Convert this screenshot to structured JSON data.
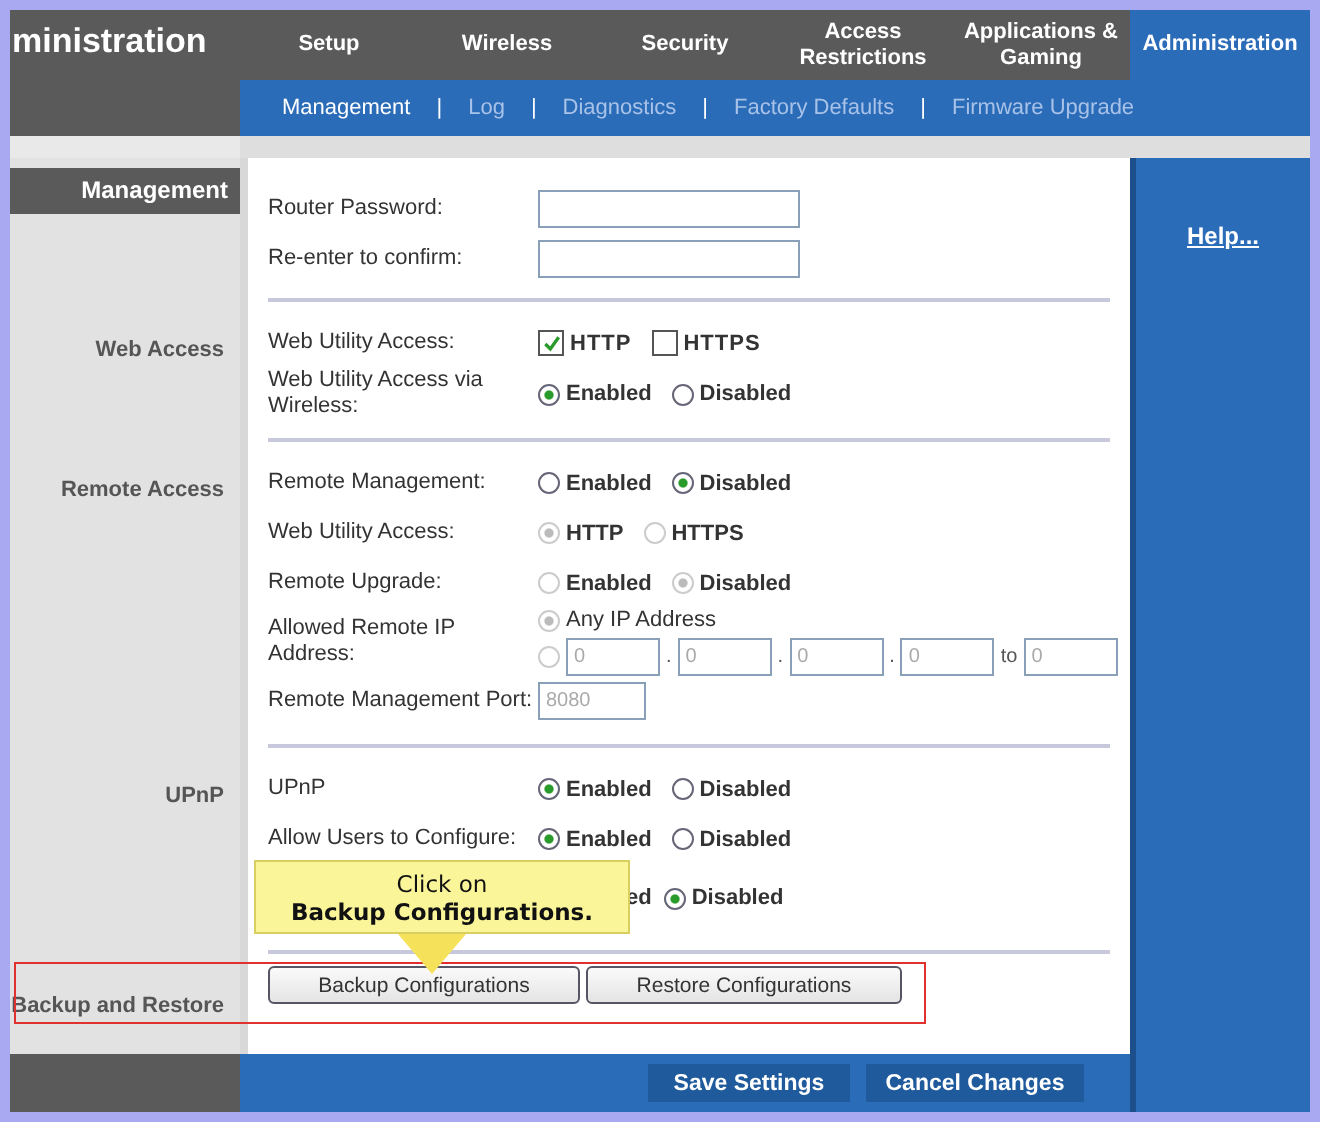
{
  "header": {
    "title": "ministration",
    "tabs": [
      {
        "label": "Setup",
        "selected": false
      },
      {
        "label": "Wireless",
        "selected": false
      },
      {
        "label": "Security",
        "selected": false
      },
      {
        "label": "Access Restrictions",
        "selected": false
      },
      {
        "label": "Applications & Gaming",
        "selected": false
      },
      {
        "label": "Administration",
        "selected": true
      }
    ]
  },
  "subtabs": [
    {
      "label": "Management",
      "selected": true
    },
    {
      "separator": "|",
      "label": "Log",
      "selected": false
    },
    {
      "separator": "|",
      "label": "Diagnostics",
      "selected": false
    },
    {
      "separator": "|",
      "label": "Factory Defaults",
      "selected": false
    },
    {
      "separator": "|",
      "label": "Firmware Upgrade",
      "selected": false
    }
  ],
  "help_link": "Help...",
  "sections": [
    {
      "heading": "Management",
      "rows": [
        {
          "kind": "password",
          "label": "Router Password:",
          "disabled": false
        },
        {
          "kind": "password",
          "label": "Re-enter to  confirm:",
          "disabled": false
        }
      ]
    },
    {
      "label": "Web Access",
      "rows": [
        {
          "kind": "checkboxes",
          "label": "Web Utility Access:",
          "disabled": false,
          "options": [
            {
              "label": "HTTP",
              "checked": true
            },
            {
              "label": "HTTPS",
              "checked": false
            }
          ]
        },
        {
          "kind": "radios",
          "label": "Web Utility Access via Wireless:",
          "disabled": false,
          "options": [
            {
              "label": "Enabled",
              "selected": true
            },
            {
              "label": "Disabled",
              "selected": false
            }
          ]
        }
      ]
    },
    {
      "label": "Remote Access",
      "rows": [
        {
          "kind": "radios",
          "label": "Remote  Management:",
          "disabled": false,
          "options": [
            {
              "label": "Enabled",
              "selected": false
            },
            {
              "label": "Disabled",
              "selected": true
            }
          ]
        },
        {
          "kind": "radios",
          "label": "Web Utility Access:",
          "disabled": true,
          "options": [
            {
              "label": "HTTP",
              "selected": true
            },
            {
              "label": "HTTPS",
              "selected": false
            }
          ]
        },
        {
          "kind": "radios",
          "label": "Remote Upgrade:",
          "disabled": true,
          "options": [
            {
              "label": "Enabled",
              "selected": false
            },
            {
              "label": "Disabled",
              "selected": true
            }
          ]
        },
        {
          "kind": "ip_choice",
          "label": "Allowed Remote IP Address:",
          "disabled": true,
          "any": {
            "label": "Any IP Address",
            "selected": true
          },
          "range": {
            "selected": false,
            "octets": [
              "0",
              "0",
              "0",
              "0"
            ],
            "separators": [
              ".",
              ".",
              "."
            ],
            "to": "to",
            "end": "0"
          }
        },
        {
          "kind": "text",
          "label": "Remote Management Port:",
          "disabled": true,
          "value": "8080"
        }
      ]
    },
    {
      "label": "UPnP",
      "rows": [
        {
          "kind": "radios",
          "label": "UPnP",
          "disabled": false,
          "options": [
            {
              "label": "Enabled",
              "selected": true
            },
            {
              "label": "Disabled",
              "selected": false
            }
          ]
        },
        {
          "kind": "radios",
          "label": "Allow Users to Configure:",
          "disabled": false,
          "options": [
            {
              "label": "Enabled",
              "selected": true
            },
            {
              "label": "Disabled",
              "selected": false
            }
          ]
        },
        {
          "kind": "radios",
          "disabled": false,
          "options": [
            {
              "label": "ed",
              "covered": true
            },
            {
              "label": "Disabled",
              "selected": true
            }
          ]
        }
      ]
    },
    {
      "label": "Backup and Restore",
      "highlighted": true,
      "buttons": [
        "Backup Configurations",
        "Restore Configurations"
      ]
    }
  ],
  "callout": "Click on\n**Backup Configurations.**",
  "footer_buttons": [
    "Save Settings",
    "Cancel Changes"
  ]
}
